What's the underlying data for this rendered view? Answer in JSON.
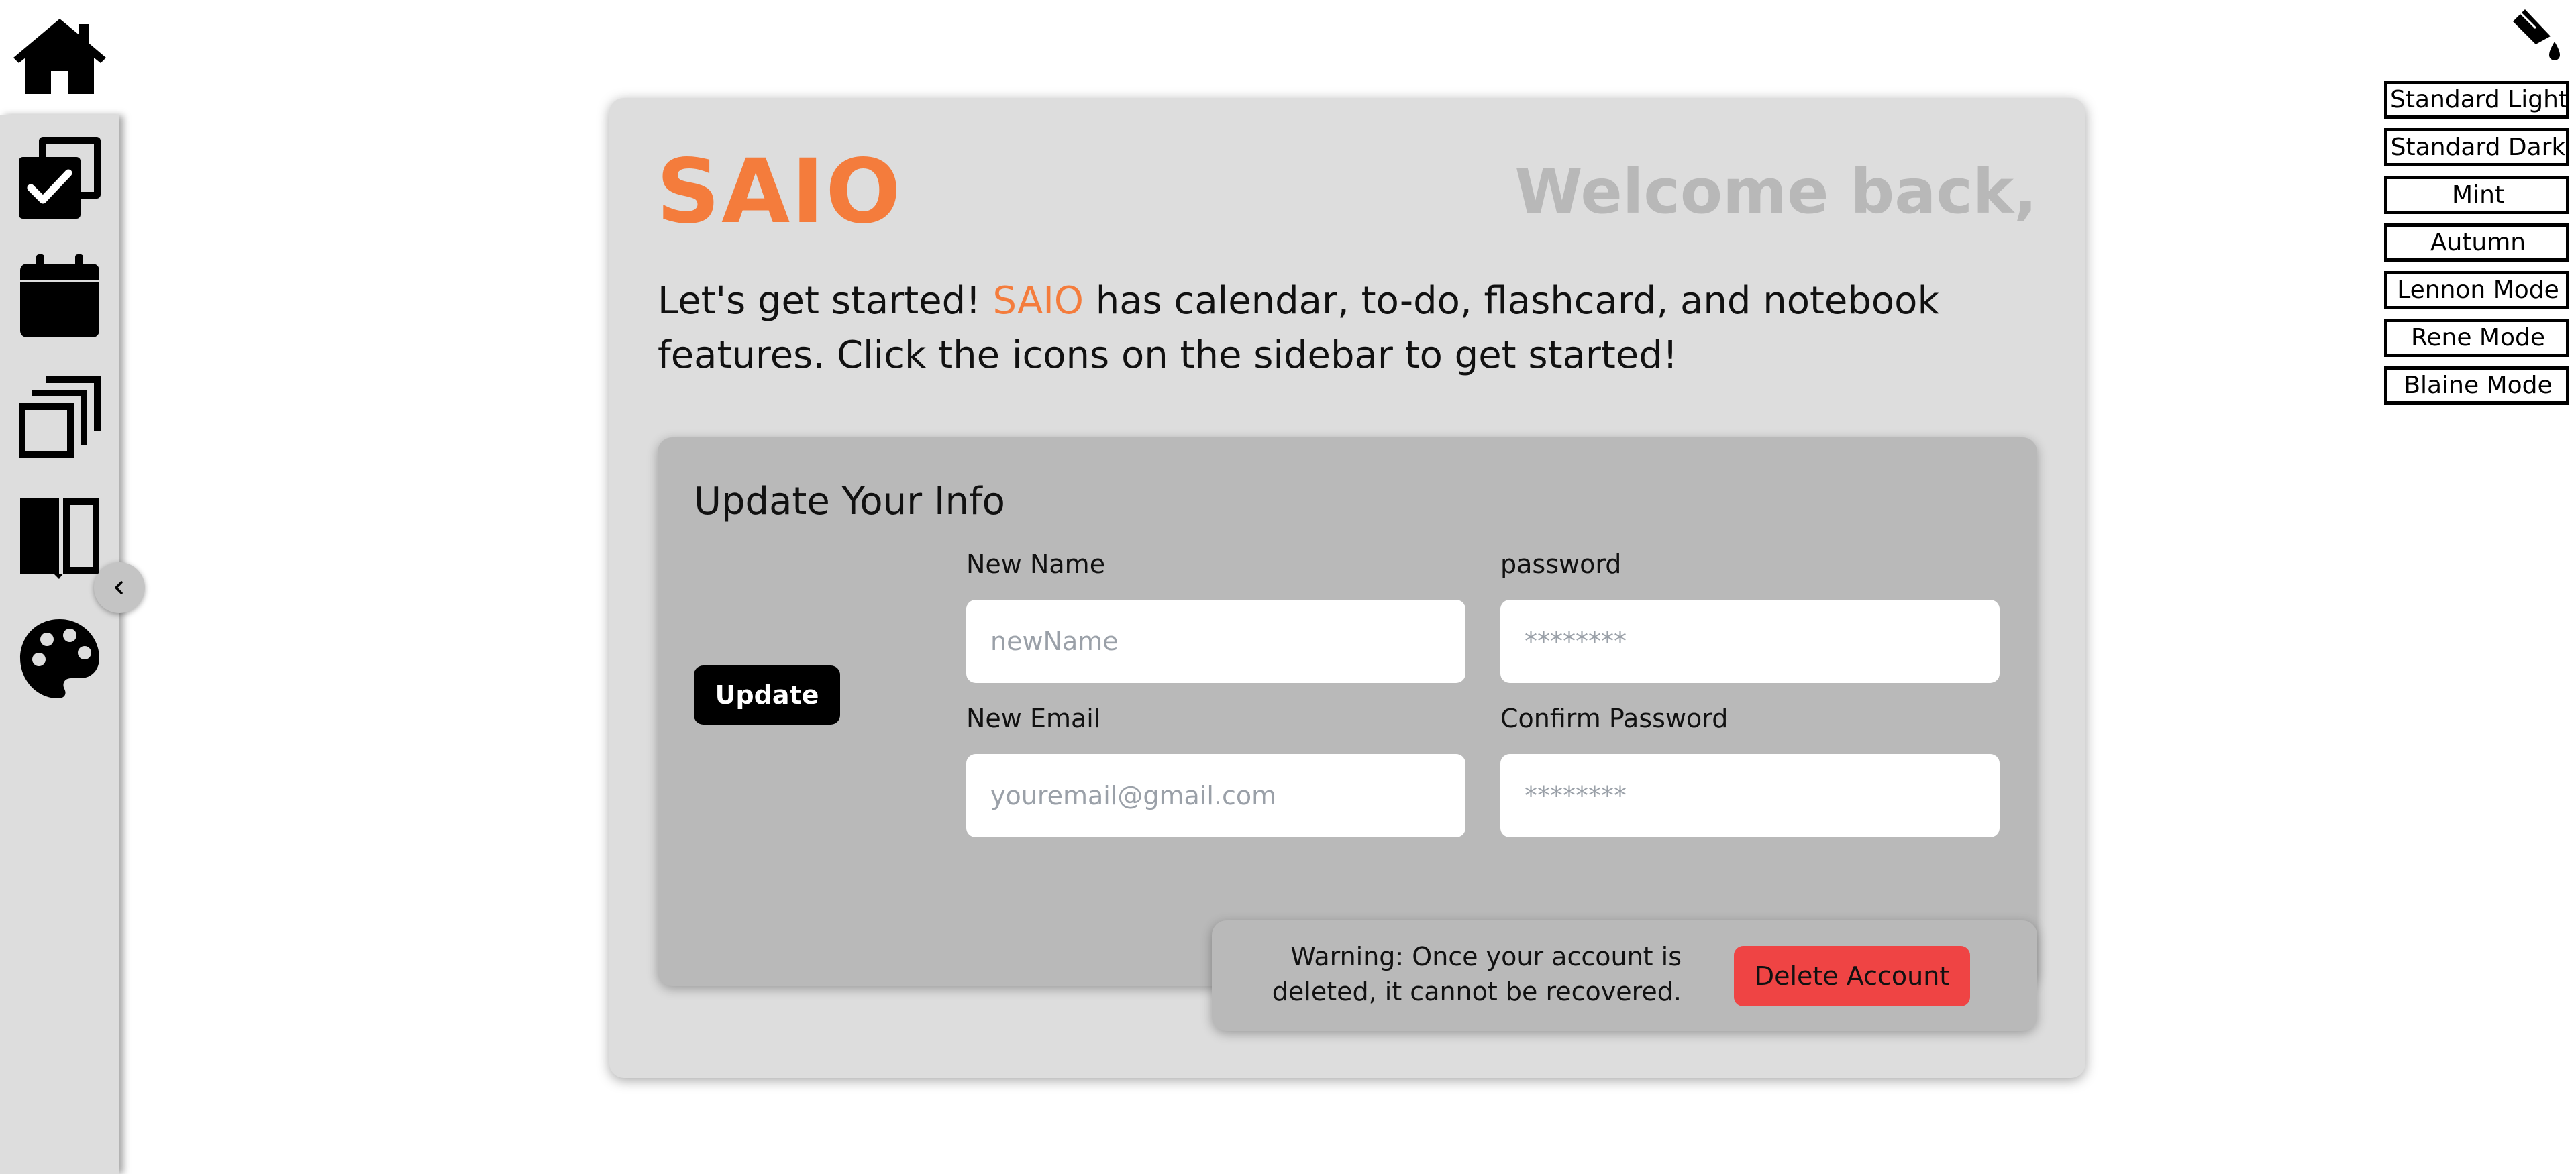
{
  "nav": {
    "home_icon": "home-icon",
    "sidebar_items": [
      {
        "name": "todo",
        "icon": "checklist-icon"
      },
      {
        "name": "calendar",
        "icon": "calendar-icon"
      },
      {
        "name": "flashcards",
        "icon": "flashcards-icon"
      },
      {
        "name": "notebook",
        "icon": "notebook-icon"
      },
      {
        "name": "theme",
        "icon": "palette-icon"
      }
    ],
    "collapse_icon": "chevron-left-icon"
  },
  "theme_picker": {
    "icon": "paint-bucket-icon",
    "options": [
      "Standard Light",
      "Standard Dark",
      "Mint",
      "Autumn",
      "Lennon Mode",
      "Rene Mode",
      "Blaine Mode"
    ]
  },
  "main": {
    "brand": "SAIO",
    "welcome": "Welcome back,",
    "intro_before": "Let's get started! ",
    "intro_brand": "SAIO",
    "intro_after": " has calendar, to-do, flashcard, and notebook features. Click the icons on the sidebar to get started!"
  },
  "update_form": {
    "title": "Update Your Info",
    "update_label": "Update",
    "name_label": "New Name",
    "name_placeholder": "newName",
    "password_label": "password",
    "password_placeholder": "********",
    "email_label": "New Email",
    "email_placeholder": "youremail@gmail.com",
    "confirm_label": "Confirm Password",
    "confirm_placeholder": "********"
  },
  "delete_section": {
    "warning": "Warning: Once your account is deleted, it cannot be recovered.",
    "button_label": "Delete Account"
  },
  "colors": {
    "accent": "#f47c3c",
    "danger": "#ef4444",
    "panel": "#dddddd",
    "subpanel": "#b9b9b9"
  }
}
